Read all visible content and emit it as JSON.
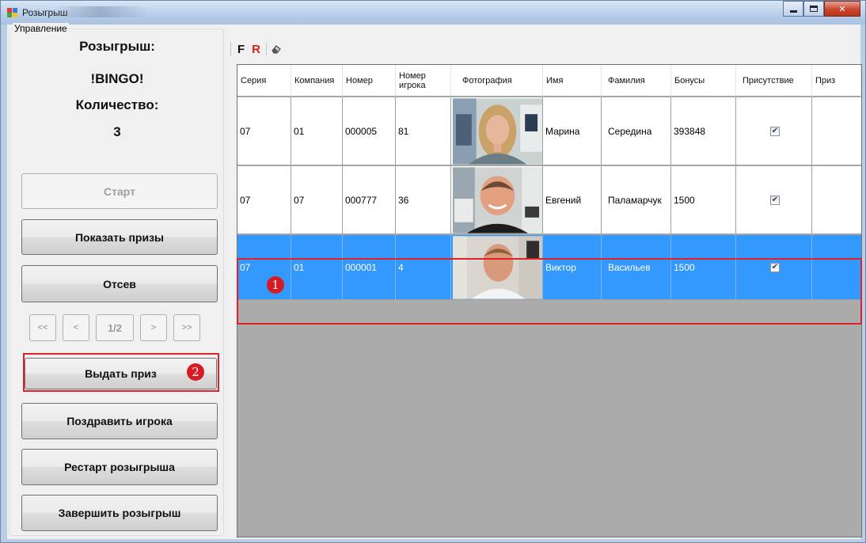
{
  "window": {
    "title": "Розыгрыш"
  },
  "panel": {
    "legend": "Управление",
    "draw_label": "Розыгрыш:",
    "draw_name": "!BINGO!",
    "count_label": "Количество:",
    "count_value": "3",
    "buttons": {
      "start": "Старт",
      "show_prizes": "Показать призы",
      "screening": "Отсев",
      "award_prize": "Выдать приз",
      "congratulate": "Поздравить игрока",
      "restart": "Рестарт розыгрыша",
      "finish": "Завершить розыгрыш"
    },
    "pager": {
      "first": "<<",
      "prev": "<",
      "page": "1/2",
      "next": ">",
      "last": ">>"
    }
  },
  "toolbar": {
    "f_label": "F",
    "r_label": "R",
    "icon": "eraser-icon"
  },
  "grid": {
    "columns": [
      "Серия",
      "Компания",
      "Номер",
      "Номер игрока",
      "Фотография",
      "Имя",
      "Фамилия",
      "Бонусы",
      "Присутствие",
      "Приз"
    ],
    "rows": [
      {
        "series": "07",
        "company": "01",
        "number": "000005",
        "player": "81",
        "first_name": "Марина",
        "last_name": "Середина",
        "bonus": "393848",
        "present": true,
        "prize": ""
      },
      {
        "series": "07",
        "company": "07",
        "number": "000777",
        "player": "36",
        "first_name": "Евгений",
        "last_name": "Паламарчук",
        "bonus": "1500",
        "present": true,
        "prize": ""
      },
      {
        "series": "07",
        "company": "01",
        "number": "000001",
        "player": "4",
        "first_name": "Виктор",
        "last_name": "Васильев",
        "bonus": "1500",
        "present": true,
        "prize": ""
      }
    ]
  },
  "markers": {
    "one": "1",
    "two": "2"
  },
  "colors": {
    "selection": "#3399ff",
    "highlight": "#e0202a",
    "titlebar": "#b9cde5"
  }
}
